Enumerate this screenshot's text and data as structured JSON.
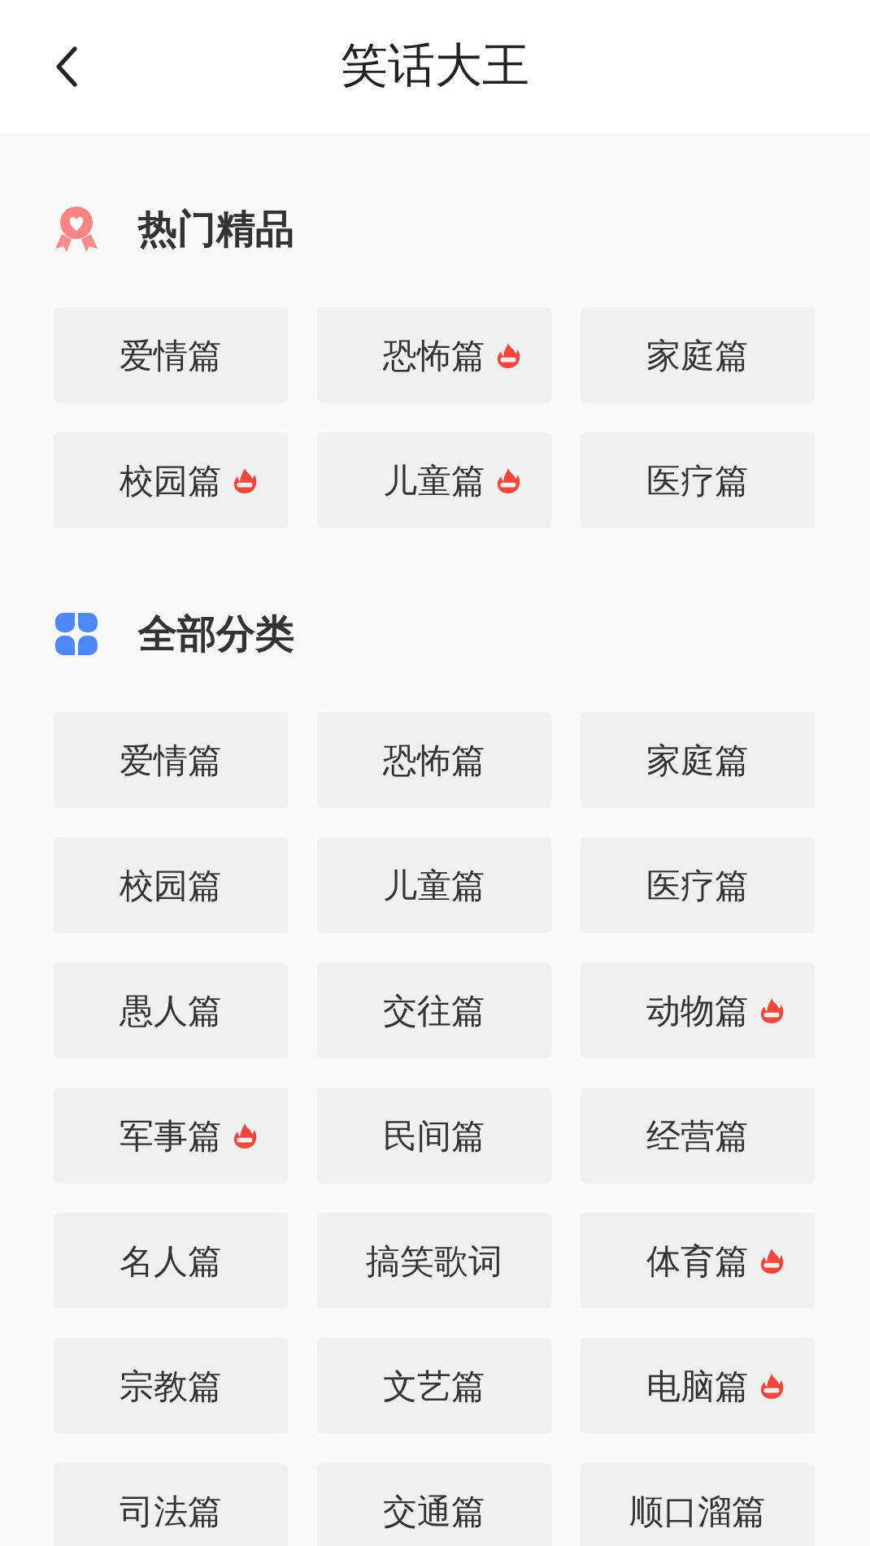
{
  "header": {
    "title": "笑话大王"
  },
  "sections": [
    {
      "kind": "hot",
      "title": "热门精品",
      "items": [
        {
          "label": "爱情篇",
          "hot": false
        },
        {
          "label": "恐怖篇",
          "hot": true
        },
        {
          "label": "家庭篇",
          "hot": false
        },
        {
          "label": "校园篇",
          "hot": true
        },
        {
          "label": "儿童篇",
          "hot": true
        },
        {
          "label": "医疗篇",
          "hot": false
        }
      ]
    },
    {
      "kind": "all",
      "title": "全部分类",
      "items": [
        {
          "label": "爱情篇",
          "hot": false
        },
        {
          "label": "恐怖篇",
          "hot": false
        },
        {
          "label": "家庭篇",
          "hot": false
        },
        {
          "label": "校园篇",
          "hot": false
        },
        {
          "label": "儿童篇",
          "hot": false
        },
        {
          "label": "医疗篇",
          "hot": false
        },
        {
          "label": "愚人篇",
          "hot": false
        },
        {
          "label": "交往篇",
          "hot": false
        },
        {
          "label": "动物篇",
          "hot": true
        },
        {
          "label": "军事篇",
          "hot": true
        },
        {
          "label": "民间篇",
          "hot": false
        },
        {
          "label": "经营篇",
          "hot": false
        },
        {
          "label": "名人篇",
          "hot": false
        },
        {
          "label": "搞笑歌词",
          "hot": false
        },
        {
          "label": "体育篇",
          "hot": true
        },
        {
          "label": "宗教篇",
          "hot": false
        },
        {
          "label": "文艺篇",
          "hot": false
        },
        {
          "label": "电脑篇",
          "hot": true
        },
        {
          "label": "司法篇",
          "hot": false
        },
        {
          "label": "交通篇",
          "hot": false
        },
        {
          "label": "顺口溜篇",
          "hot": false
        }
      ]
    }
  ]
}
